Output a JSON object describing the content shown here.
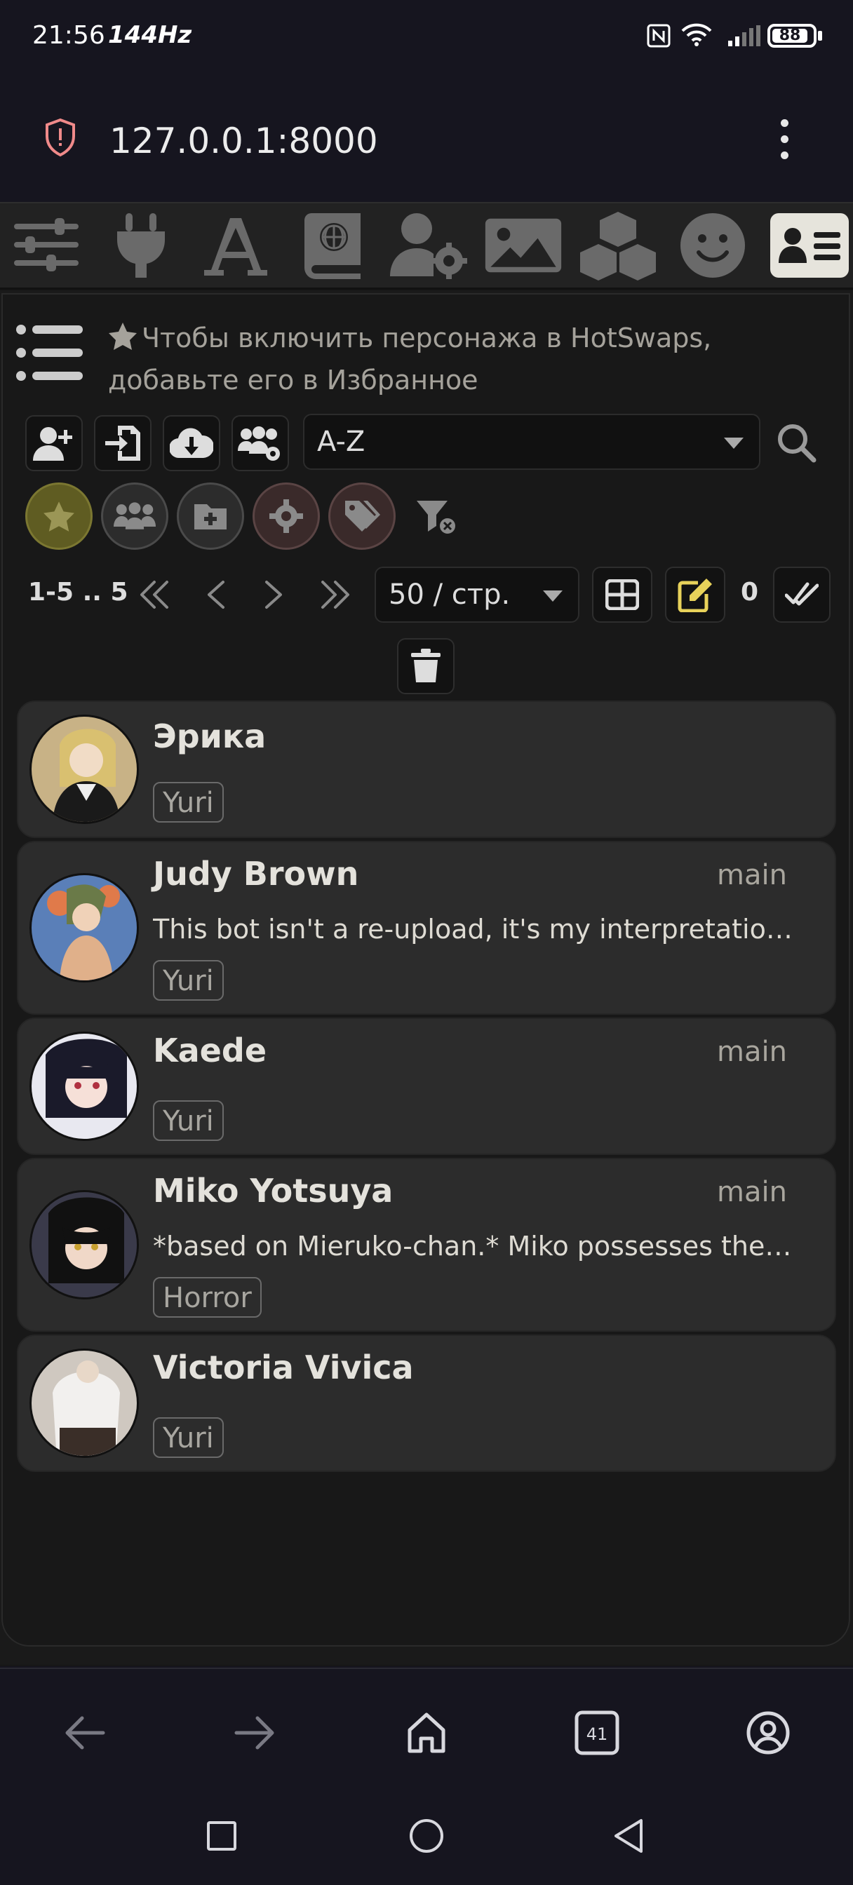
{
  "status_bar": {
    "time": "21:56",
    "refresh": "144Hz",
    "battery": "88"
  },
  "browser": {
    "url": "127.0.0.1:8000",
    "tabs_count": "41"
  },
  "topbar_icons": [
    "sliders-icon",
    "plug-icon",
    "font-icon",
    "book-globe-icon",
    "user-gear-icon",
    "image-icon",
    "cubes-icon",
    "smile-icon",
    "address-card-icon"
  ],
  "panel": {
    "hint": "Чтобы включить персонажа в HotSwaps, добавьте его в Избранное",
    "sort_value": "A-Z",
    "pagination_range": "1-5 .. 5",
    "per_page": "50 / стр.",
    "selected_count": "0"
  },
  "characters": [
    {
      "name": "Эрика",
      "main": "",
      "desc": "",
      "tag": "Yuri"
    },
    {
      "name": "Judy Brown",
      "main": "main",
      "desc": "This bot isn't a re-upload, it's my interpretation of the character from another upload…",
      "tag": "Yuri"
    },
    {
      "name": "Kaede",
      "main": "main",
      "desc": "",
      "tag": "Yuri"
    },
    {
      "name": "Miko Yotsuya",
      "main": "main",
      "desc": "*based on Mieruko-chan.* Miko possesses the ability to see spirits…",
      "tag": "Horror"
    },
    {
      "name": "Victoria Vivica",
      "main": "",
      "desc": "",
      "tag": "Yuri"
    }
  ],
  "colors": {
    "background": "#16151f",
    "card": "#2c2c2c",
    "accent_star": "#6e6a26",
    "edit_icon": "#e8d25a"
  }
}
